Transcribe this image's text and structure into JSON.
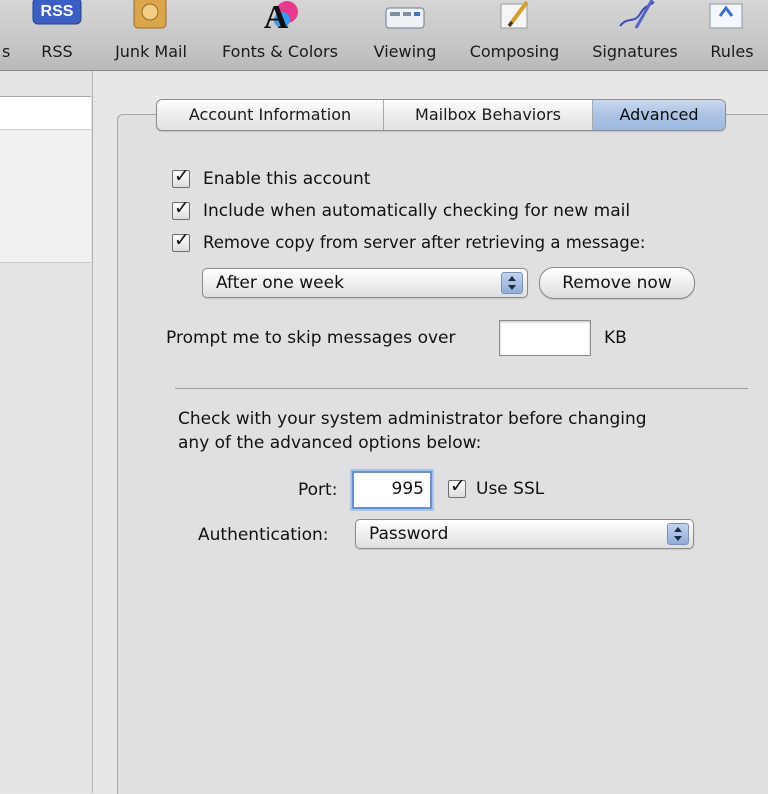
{
  "toolbar": {
    "items": [
      {
        "label": "s",
        "icon": "general-icon"
      },
      {
        "label": "RSS",
        "icon": "rss-icon"
      },
      {
        "label": "Junk Mail",
        "icon": "junk-mail-icon"
      },
      {
        "label": "Fonts & Colors",
        "icon": "fonts-colors-icon"
      },
      {
        "label": "Viewing",
        "icon": "viewing-icon"
      },
      {
        "label": "Composing",
        "icon": "composing-icon"
      },
      {
        "label": "Signatures",
        "icon": "signatures-icon"
      },
      {
        "label": "Rules",
        "icon": "rules-icon"
      }
    ],
    "rss_badge": "RSS",
    "fonts_glyph": "A"
  },
  "tabs": [
    {
      "label": "Account Information",
      "selected": false
    },
    {
      "label": "Mailbox Behaviors",
      "selected": false
    },
    {
      "label": "Advanced",
      "selected": true
    }
  ],
  "options": {
    "enable_account": {
      "label": "Enable this account",
      "checked": true
    },
    "include_auto_check": {
      "label": "Include when automatically checking for new mail",
      "checked": true
    },
    "remove_copy": {
      "label": "Remove copy from server after retrieving a message:",
      "checked": true
    },
    "remove_after": {
      "value": "After one week"
    },
    "remove_now_label": "Remove now",
    "prompt_label": "Prompt me to skip messages over",
    "prompt_value": "",
    "prompt_unit": "KB"
  },
  "advanced": {
    "notice": "Check with your system administrator before changing any of the advanced options below:",
    "notice_line1": "Check with your system administrator before changing",
    "notice_line2": "any of the advanced options below:",
    "port_label": "Port:",
    "port_value": "995",
    "use_ssl": {
      "label": "Use SSL",
      "checked": true
    },
    "auth_label": "Authentication:",
    "auth_value": "Password"
  },
  "colors": {
    "selected_tab": "#a9c1e3",
    "popup_arrows": "#8fadd9",
    "rss_badge": "#3c5fc4"
  }
}
